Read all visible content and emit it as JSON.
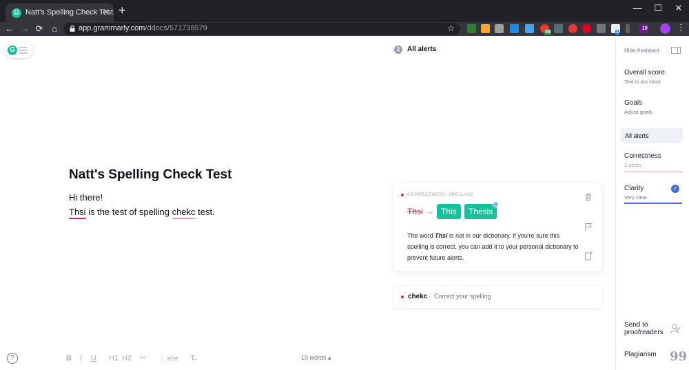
{
  "browser": {
    "tab_title": "Natt's Spelling Check Test",
    "tab_close": "✕",
    "new_tab": "+",
    "url_host": "app.grammarly.com",
    "url_path": "/ddocs/571738579",
    "ext_badges": [
      "59",
      "1",
      "10"
    ],
    "window": {
      "minimize": "—",
      "maximize": "☐",
      "close": "✕"
    }
  },
  "editor": {
    "logo": "G",
    "title": "Natt's Spelling Check Test",
    "line1": "Hi there!",
    "line2": {
      "err1": "Thsi",
      "mid": " is the test of spelling ",
      "err2": "chekc",
      "end": " test."
    },
    "footer": {
      "help": "?",
      "bold": "B",
      "italic": "I",
      "underline": "U",
      "h1": "H1",
      "h2": "H2",
      "link": "🔗",
      "ol": "⋮☰",
      "ul": "⁝☰",
      "clear": "T̸",
      "word_count": "10 words ▴"
    }
  },
  "alerts": {
    "count": "2",
    "title": "All alerts",
    "card": {
      "category": "CORRECTNESS: SPELLING",
      "original": "Thsi",
      "arrow": "→",
      "suggestions": [
        "This",
        "Thesis"
      ],
      "desc_pre": "The word ",
      "desc_word": "Thsi",
      "desc_post": " is not in our dictionary. If you're sure this spelling is correct, you can add it to your personal dictionary to prevent future alerts."
    },
    "card2": {
      "word": "chekc",
      "sep": "·",
      "message": "Correct your spelling"
    }
  },
  "sidebar": {
    "hide": "Hide Assistant",
    "overall_score": {
      "label": "Overall score",
      "sub": "Text is too short"
    },
    "goals": {
      "label": "Goals",
      "sub": "Adjust goals"
    },
    "all_alerts": "All alerts",
    "correctness": {
      "label": "Correctness",
      "sub": "2 alerts"
    },
    "clarity": {
      "label": "Clarity",
      "sub": "Very clear"
    },
    "send": {
      "line1": "Send to",
      "line2": "proofreaders"
    },
    "plagiarism": "Plagiarism",
    "plagiarism_icon": "99"
  },
  "colors": {
    "grammarly_green": "#15c39a",
    "error_red": "#d6294f",
    "clarity_blue": "#4a6ee0",
    "correctness_bar": "#f3c9d3"
  }
}
